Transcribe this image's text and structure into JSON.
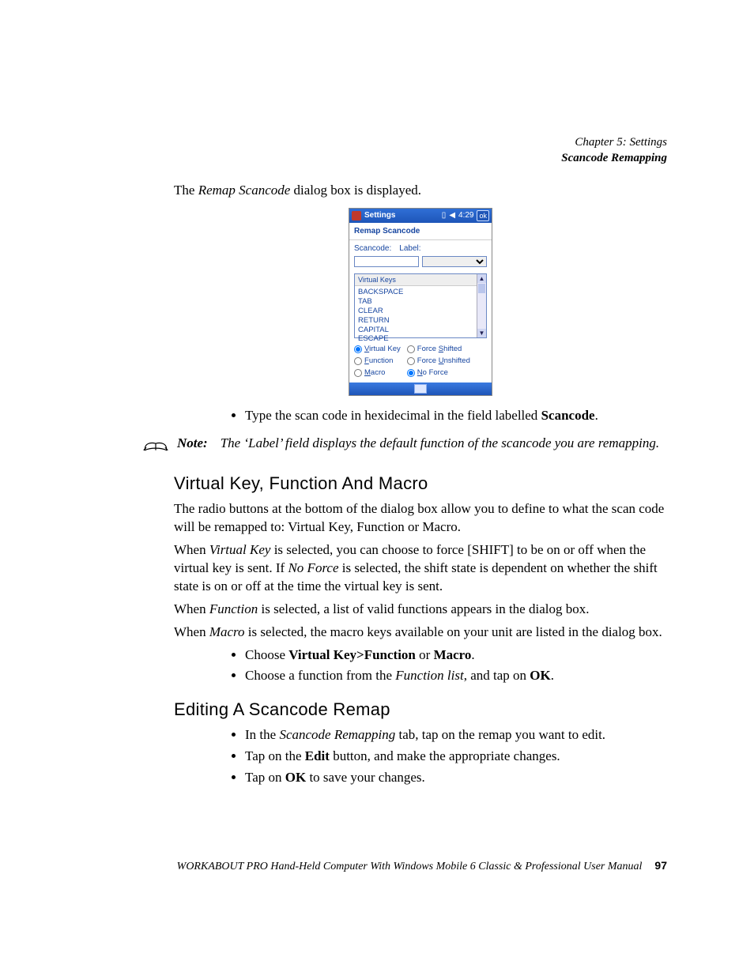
{
  "header": {
    "chapter": "Chapter 5: Settings",
    "section": "Scancode Remapping"
  },
  "intro": {
    "pre": "The ",
    "em": "Remap Scancode",
    "post": " dialog box is displayed."
  },
  "screenshot": {
    "title": "Settings",
    "time": "4:29",
    "ok": "ok",
    "subtitle": "Remap Scancode",
    "scancode_label": "Scancode:",
    "label_label": "Label:",
    "scancode_value": "",
    "dropdown_value": "",
    "list_header": "Virtual Keys",
    "list_items": [
      "BACKSPACE",
      "TAB",
      "CLEAR",
      "RETURN",
      "CAPITAL",
      "ESCAPE"
    ],
    "radios_left": [
      {
        "label": "Virtual Key",
        "ul": "V",
        "checked": true
      },
      {
        "label": "Function",
        "ul": "F",
        "checked": false
      },
      {
        "label": "Macro",
        "ul": "M",
        "checked": false
      }
    ],
    "radios_right": [
      {
        "label": "Force Shifted",
        "ul": "S",
        "checked": false
      },
      {
        "label": "Force Unshifted",
        "ul": "U",
        "checked": false
      },
      {
        "label": "No Force",
        "ul": "N",
        "checked": true
      }
    ]
  },
  "bullet1": {
    "pre": "Type the scan code in hexidecimal in the field labelled ",
    "b": "Scancode",
    "post": "."
  },
  "note": {
    "label": "Note:",
    "text": "The ‘Label’ field displays the default function of the scancode you are remapping."
  },
  "sec1": {
    "title": "Virtual Key, Function And Macro",
    "p1": "The radio buttons at the bottom of the dialog box allow you to define to what the scan code will be remapped to: Virtual Key, Function or Macro.",
    "p2": {
      "a": "When ",
      "e1": "Virtual Key",
      "b": " is selected, you can choose to force [SHIFT] to be on or off when the virtual key is sent. If ",
      "e2": "No Force",
      "c": " is selected, the shift state is dependent on whether the shift state is on or off at the time the virtual key is sent."
    },
    "p3": {
      "a": "When ",
      "e": "Function",
      "b": " is selected, a list of valid functions appears in the dialog box."
    },
    "p4": {
      "a": "When ",
      "e": "Macro",
      "b": " is selected, the macro keys available on your unit are listed in the dialog box."
    },
    "b1": {
      "a": "Choose ",
      "s1": "Virtual Key>Function",
      "b": " or ",
      "s2": "Macro",
      "c": "."
    },
    "b2": {
      "a": "Choose a function from the ",
      "e": "Function list",
      "b": ", and tap on ",
      "s": "OK",
      "c": "."
    }
  },
  "sec2": {
    "title": "Editing A Scancode Remap",
    "b1": {
      "a": "In the ",
      "e": "Scancode Remapping",
      "b": " tab, tap on the remap you want to edit."
    },
    "b2": {
      "a": "Tap on the ",
      "s": "Edit",
      "b": " button, and make the appropriate changes."
    },
    "b3": {
      "a": "Tap on ",
      "s": "OK",
      "b": " to save your changes."
    }
  },
  "footer": {
    "text": "WORKABOUT PRO Hand-Held Computer With Windows Mobile 6 Classic & Professional User Manual",
    "page": "97"
  }
}
